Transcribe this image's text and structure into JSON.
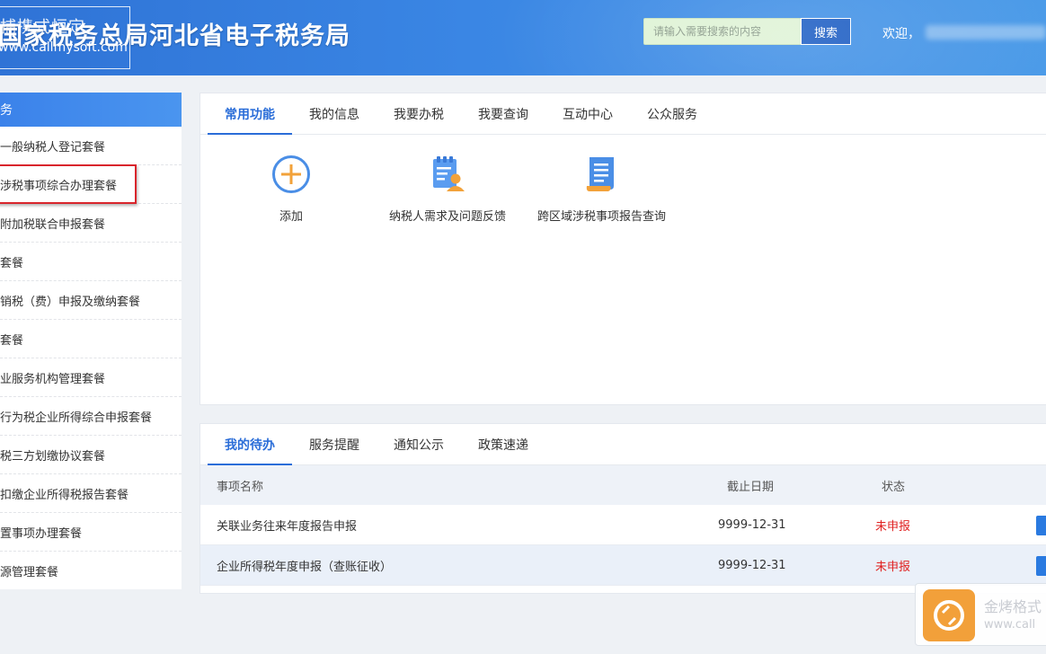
{
  "header": {
    "site_title": "国家税务总局河北省电子税务局",
    "logo_small": "捕携式恒定",
    "logo_url": "www.callmysoft.com",
    "search_placeholder": "请输入需要搜索的内容",
    "search_label": "搜索",
    "welcome": "欢迎，"
  },
  "sidebar": {
    "header": "务",
    "items": [
      {
        "label": "一般纳税人登记套餐"
      },
      {
        "label": "涉税事项综合办理套餐"
      },
      {
        "label": "附加税联合申报套餐"
      },
      {
        "label": "套餐"
      },
      {
        "label": "销税（费）申报及缴纳套餐"
      },
      {
        "label": "套餐"
      },
      {
        "label": "业服务机构管理套餐"
      },
      {
        "label": "行为税企业所得综合申报套餐"
      },
      {
        "label": "税三方划缴协议套餐"
      },
      {
        "label": "扣缴企业所得税报告套餐"
      },
      {
        "label": "置事项办理套餐"
      },
      {
        "label": "源管理套餐"
      }
    ]
  },
  "main": {
    "tabs": [
      {
        "label": "常用功能"
      },
      {
        "label": "我的信息"
      },
      {
        "label": "我要办税"
      },
      {
        "label": "我要查询"
      },
      {
        "label": "互动中心"
      },
      {
        "label": "公众服务"
      }
    ],
    "functions": [
      {
        "label": "添加",
        "icon": "add-circle-icon"
      },
      {
        "label": "纳税人需求及问题反馈",
        "icon": "feedback-clipboard-icon"
      },
      {
        "label": "跨区域涉税事项报告查询",
        "icon": "document-report-icon"
      }
    ]
  },
  "todo": {
    "tabs": [
      {
        "label": "我的待办"
      },
      {
        "label": "服务提醒"
      },
      {
        "label": "通知公示"
      },
      {
        "label": "政策速递"
      }
    ],
    "columns": {
      "name": "事项名称",
      "date": "截止日期",
      "status": "状态"
    },
    "rows": [
      {
        "name": "关联业务往来年度报告申报",
        "date": "9999-12-31",
        "status": "未申报"
      },
      {
        "name": "企业所得税年度申报（查账征收）",
        "date": "9999-12-31",
        "status": "未申报"
      }
    ]
  },
  "widget": {
    "text1": "金烤格式",
    "text2": "www.call"
  },
  "colors": {
    "accent": "#2a6dd8",
    "header_blue": "#3a86e4",
    "status_red": "#e02020",
    "highlight_red": "#d9252c",
    "widget_orange": "#f2a03a"
  }
}
